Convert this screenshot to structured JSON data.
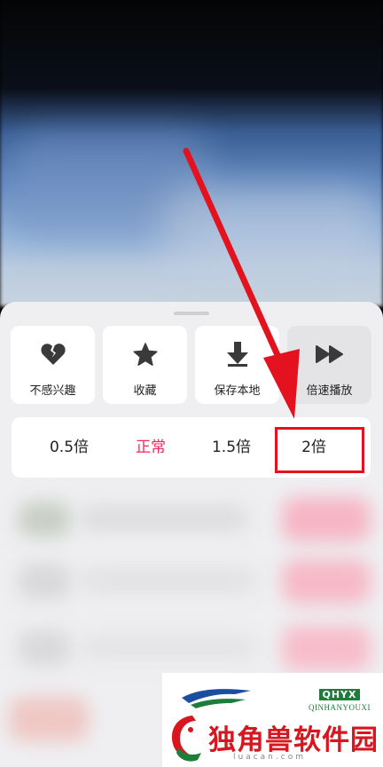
{
  "actions": [
    {
      "label": "不感兴趣",
      "icon": "broken-heart-icon"
    },
    {
      "label": "收藏",
      "icon": "star-icon"
    },
    {
      "label": "保存本地",
      "icon": "download-icon"
    },
    {
      "label": "倍速播放",
      "icon": "fast-forward-icon"
    }
  ],
  "speed_options": [
    "0.5倍",
    "正常",
    "1.5倍",
    "2倍"
  ],
  "selected_speed": "正常",
  "colors": {
    "accent": "#ee2a58",
    "annotation": "#e3121e"
  },
  "watermark": {
    "code": "QHYX",
    "sub": "QINHANYOUXI",
    "name": "独角兽软件园",
    "url": "luacan.com"
  }
}
